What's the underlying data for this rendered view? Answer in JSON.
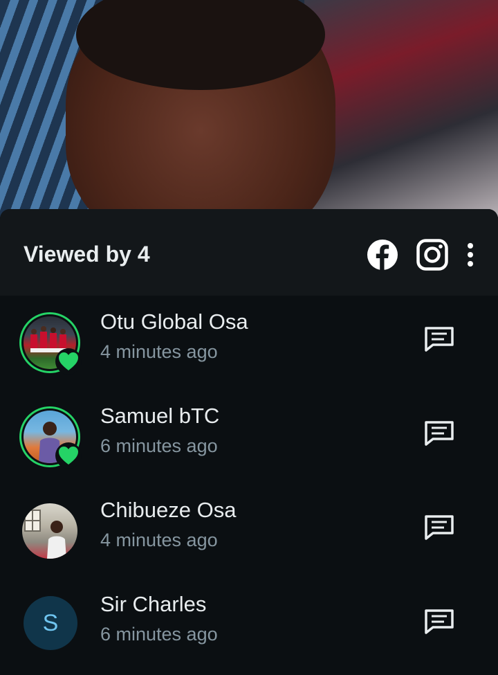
{
  "status": {
    "image": "status-photo"
  },
  "sheet": {
    "title": "Viewed by 4",
    "icons": [
      "facebook-icon",
      "instagram-icon",
      "more-vert-icon"
    ]
  },
  "viewers": [
    {
      "name": "Otu Global Osa",
      "time": "4 minutes ago",
      "liked": true
    },
    {
      "name": "Samuel bTC",
      "time": "6 minutes ago",
      "liked": true
    },
    {
      "name": "Chibueze Osa",
      "time": "4 minutes ago",
      "liked": false
    },
    {
      "name": "Sir Charles",
      "time": "6 minutes ago",
      "liked": false,
      "initial": "S"
    }
  ],
  "colors": {
    "accent": "#25d366",
    "background": "#0b0f12",
    "header": "#13171a",
    "text_primary": "#e9edef",
    "text_secondary": "#8696a0"
  }
}
